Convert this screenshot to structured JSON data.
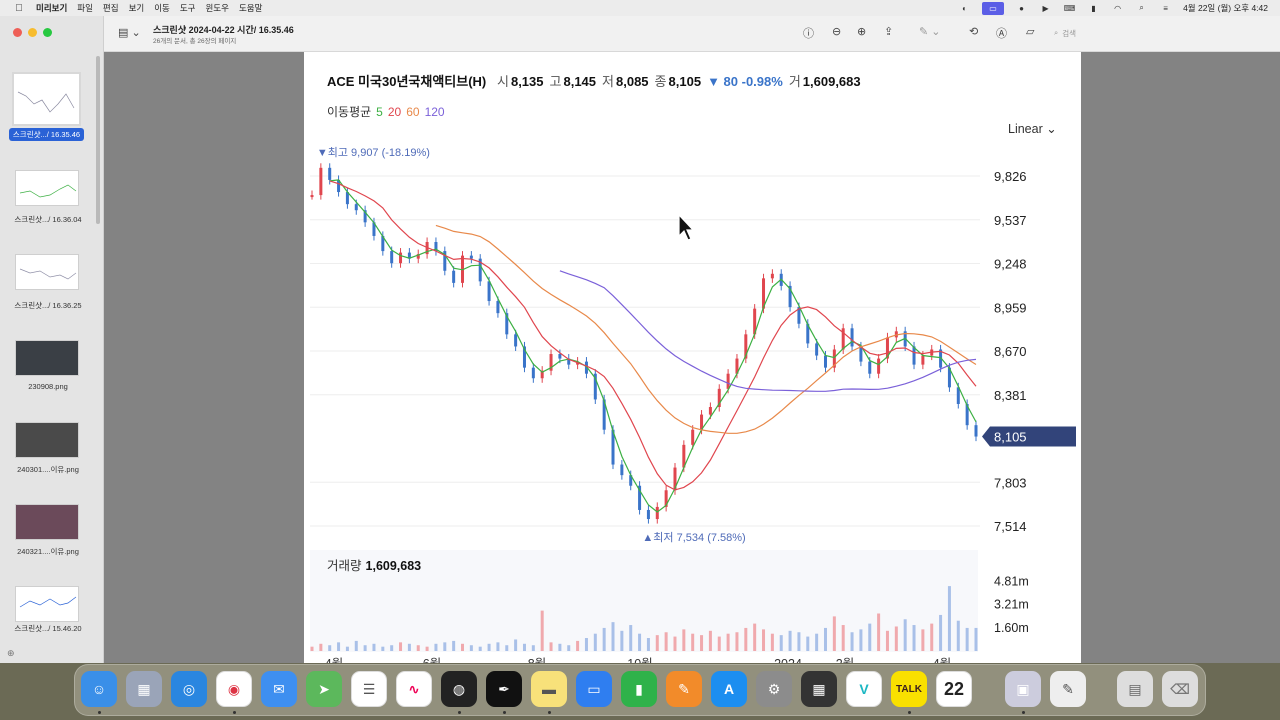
{
  "menubar": {
    "app_name": "미리보기",
    "items": [
      "파일",
      "편집",
      "보기",
      "이동",
      "도구",
      "윈도우",
      "도움말"
    ],
    "clock": "4월 22일 (월) 오후 4:42"
  },
  "toolbar": {
    "title": "스크린샷 2024-04-22 시간/ 16.35.46",
    "subtitle": "26개의 문서, 총 26장의 페이지",
    "search_placeholder": "검색"
  },
  "sidebar": {
    "thumbnails": [
      {
        "label": "스크린샷.../ 16.35.46",
        "selected": true
      },
      {
        "label": "스크린샷.../ 16.36.04",
        "selected": false
      },
      {
        "label": "스크린샷.../ 16.36.25",
        "selected": false
      },
      {
        "label": "230908.png",
        "selected": false
      },
      {
        "label": "240301....이유.png",
        "selected": false
      },
      {
        "label": "240321....이유.png",
        "selected": false
      },
      {
        "label": "스크린샷.../ 15.46.20",
        "selected": false
      }
    ]
  },
  "chart_data": {
    "type": "candlestick",
    "title": "ACE 미국30년국채액티브(H)",
    "quote": {
      "open_label": "시",
      "open": "8,135",
      "high_label": "고",
      "high": "8,145",
      "low_label": "저",
      "low": "8,085",
      "close_label": "종",
      "close": "8,105",
      "change": "▼ 80 -0.98%",
      "volume_label": "거",
      "volume": "1,609,683"
    },
    "ma_legend": {
      "label": "이동평균",
      "periods": [
        "5",
        "20",
        "60",
        "120"
      ],
      "colors": [
        "#3cb043",
        "#e0464e",
        "#e8894a",
        "#7b61d9"
      ]
    },
    "scale_mode": "Linear",
    "y_ticks": [
      9826,
      9537,
      9248,
      8959,
      8670,
      8381,
      7803,
      7514
    ],
    "y_tick_labels": [
      "9,826",
      "9,537",
      "9,248",
      "8,959",
      "8,670",
      "8,381",
      "7,803",
      "7,514"
    ],
    "current_price_label": "8,105",
    "current_price": 8105,
    "max_annotation": "▼최고 9,907 (-18.19%)",
    "min_annotation": "▲최저 7,534 (7.58%)",
    "x_labels": [
      "4월",
      "6월",
      "8월",
      "10월",
      "2024",
      "2월",
      "4월"
    ],
    "close_series": [
      9700,
      9880,
      9800,
      9720,
      9640,
      9600,
      9520,
      9430,
      9330,
      9250,
      9320,
      9280,
      9310,
      9390,
      9330,
      9200,
      9120,
      9300,
      9280,
      9130,
      9000,
      8920,
      8780,
      8700,
      8560,
      8490,
      8540,
      8650,
      8620,
      8580,
      8600,
      8520,
      8350,
      8150,
      7920,
      7850,
      7780,
      7620,
      7560,
      7640,
      7750,
      7900,
      8050,
      8150,
      8250,
      8300,
      8420,
      8520,
      8620,
      8780,
      8950,
      9150,
      9180,
      9100,
      8960,
      8850,
      8720,
      8640,
      8560,
      8680,
      8820,
      8700,
      8600,
      8520,
      8620,
      8760,
      8800,
      8700,
      8580,
      8640,
      8680,
      8560,
      8430,
      8320,
      8180,
      8105
    ],
    "volume": {
      "label": "거래량",
      "value": "1,609,683",
      "ticks": [
        "4.81m",
        "3.21m",
        "1.60m"
      ],
      "tick_values": [
        4.81,
        3.21,
        1.6
      ],
      "bars": [
        0.3,
        0.5,
        0.4,
        0.6,
        0.3,
        0.7,
        0.4,
        0.5,
        0.3,
        0.4,
        0.6,
        0.5,
        0.4,
        0.3,
        0.5,
        0.6,
        0.7,
        0.5,
        0.4,
        0.3,
        0.5,
        0.6,
        0.4,
        0.8,
        0.5,
        0.4,
        2.8,
        0.6,
        0.5,
        0.4,
        0.7,
        0.9,
        1.2,
        1.6,
        2.0,
        1.4,
        1.8,
        1.2,
        0.9,
        1.1,
        1.3,
        1.0,
        1.5,
        1.2,
        1.1,
        1.4,
        1.0,
        1.2,
        1.3,
        1.6,
        1.9,
        1.5,
        1.2,
        1.1,
        1.4,
        1.3,
        1.0,
        1.2,
        1.6,
        2.4,
        1.8,
        1.3,
        1.5,
        1.9,
        2.6,
        1.4,
        1.7,
        2.2,
        1.8,
        1.5,
        1.9,
        2.5,
        4.5,
        2.1,
        1.6,
        1.6
      ]
    }
  }
}
